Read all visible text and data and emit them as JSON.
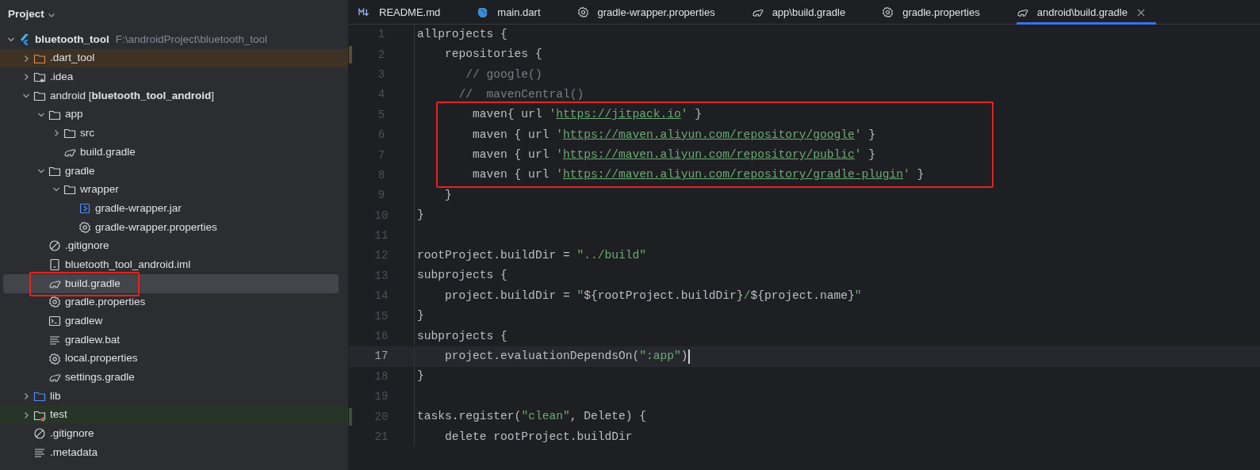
{
  "project_panel": {
    "title": "Project",
    "tree": [
      {
        "label": "bluetooth_tool",
        "path": "F:\\androidProject\\bluetooth_tool",
        "kind": "flutter",
        "expanded": true,
        "selected": false,
        "children": [
          {
            "label": ".dart_tool",
            "kind": "excluded-folder",
            "expanded": false,
            "selected": false
          },
          {
            "label": ".idea",
            "kind": "idea-folder",
            "expanded": false,
            "selected": false
          },
          {
            "label": "android [**bluetooth_tool_android**]",
            "kind": "folder",
            "expanded": true,
            "selected": false,
            "children": [
              {
                "label": "app",
                "kind": "folder",
                "expanded": true,
                "selected": false,
                "children": [
                  {
                    "label": "src",
                    "kind": "folder",
                    "expanded": false,
                    "selected": false
                  },
                  {
                    "label": "build.gradle",
                    "kind": "gradle",
                    "selected": false
                  }
                ]
              },
              {
                "label": "gradle",
                "kind": "folder",
                "expanded": true,
                "selected": false,
                "children": [
                  {
                    "label": "wrapper",
                    "kind": "folder",
                    "expanded": true,
                    "selected": false,
                    "children": [
                      {
                        "label": "gradle-wrapper.jar",
                        "kind": "jar",
                        "selected": false
                      },
                      {
                        "label": "gradle-wrapper.properties",
                        "kind": "settings",
                        "selected": false
                      }
                    ]
                  }
                ]
              },
              {
                "label": ".gitignore",
                "kind": "ignore",
                "selected": false
              },
              {
                "label": "bluetooth_tool_android.iml",
                "kind": "module",
                "selected": false
              },
              {
                "label": "build.gradle",
                "kind": "gradle",
                "selected": true,
                "boxed": true
              },
              {
                "label": "gradle.properties",
                "kind": "settings",
                "selected": false
              },
              {
                "label": "gradlew",
                "kind": "terminal",
                "selected": false
              },
              {
                "label": "gradlew.bat",
                "kind": "text",
                "selected": false
              },
              {
                "label": "local.properties",
                "kind": "settings",
                "selected": false
              },
              {
                "label": "settings.gradle",
                "kind": "gradle",
                "selected": false
              }
            ]
          },
          {
            "label": "lib",
            "kind": "source-folder",
            "expanded": false,
            "selected": false
          },
          {
            "label": "test",
            "kind": "test-folder",
            "expanded": false,
            "selected": false
          },
          {
            "label": ".gitignore",
            "kind": "ignore",
            "selected": false
          },
          {
            "label": ".metadata",
            "kind": "text",
            "selected": false
          }
        ]
      }
    ]
  },
  "editor": {
    "tabs": [
      {
        "label": "README.md",
        "kind": "markdown",
        "selected": false,
        "closable": false
      },
      {
        "label": "main.dart",
        "kind": "dart",
        "selected": false,
        "closable": false
      },
      {
        "label": "gradle-wrapper.properties",
        "kind": "settings",
        "selected": false,
        "closable": false
      },
      {
        "label": "app\\build.gradle",
        "kind": "gradle",
        "selected": false,
        "closable": false
      },
      {
        "label": "gradle.properties",
        "kind": "settings",
        "selected": false,
        "closable": false
      },
      {
        "label": "android\\build.gradle",
        "kind": "gradle",
        "selected": true,
        "closable": true
      }
    ],
    "lines": [
      {
        "number": "1",
        "current": false,
        "tokens": [
          {
            "kind": "plain",
            "text": "allprojects {"
          }
        ]
      },
      {
        "number": "2",
        "current": false,
        "color": "#5c4b2d",
        "tokens": [
          {
            "kind": "plain",
            "text": "    repositories {"
          }
        ]
      },
      {
        "number": "3",
        "current": false,
        "tokens": [
          {
            "kind": "comment",
            "text": "       // google()"
          }
        ]
      },
      {
        "number": "4",
        "current": false,
        "tokens": [
          {
            "kind": "comment",
            "text": "      //  mavenCentral()"
          }
        ]
      },
      {
        "number": "5",
        "current": false,
        "boxed": true,
        "tokens": [
          {
            "kind": "plain",
            "text": "        maven{ url "
          },
          {
            "kind": "string",
            "text": "'"
          },
          {
            "kind": "link",
            "text": "https://jitpack.io"
          },
          {
            "kind": "string",
            "text": "'"
          },
          {
            "kind": "plain",
            "text": " }"
          }
        ]
      },
      {
        "number": "6",
        "current": false,
        "boxed": true,
        "tokens": [
          {
            "kind": "plain",
            "text": "        maven { url "
          },
          {
            "kind": "string",
            "text": "'"
          },
          {
            "kind": "link",
            "text": "https://maven.aliyun.com/repository/google"
          },
          {
            "kind": "string",
            "text": "'"
          },
          {
            "kind": "plain",
            "text": " }"
          }
        ]
      },
      {
        "number": "7",
        "current": false,
        "boxed": true,
        "tokens": [
          {
            "kind": "plain",
            "text": "        maven { url "
          },
          {
            "kind": "string",
            "text": "'"
          },
          {
            "kind": "link",
            "text": "https://maven.aliyun.com/repository/public"
          },
          {
            "kind": "string",
            "text": "'"
          },
          {
            "kind": "plain",
            "text": " }"
          }
        ]
      },
      {
        "number": "8",
        "current": false,
        "boxed": true,
        "tokens": [
          {
            "kind": "plain",
            "text": "        maven { url "
          },
          {
            "kind": "string",
            "text": "'"
          },
          {
            "kind": "link",
            "text": "https://maven.aliyun.com/repository/gradle-plugin"
          },
          {
            "kind": "string",
            "text": "'"
          },
          {
            "kind": "plain",
            "text": " }"
          }
        ]
      },
      {
        "number": "9",
        "current": false,
        "tokens": [
          {
            "kind": "plain",
            "text": "    }"
          }
        ]
      },
      {
        "number": "10",
        "current": false,
        "tokens": [
          {
            "kind": "plain",
            "text": "}"
          }
        ]
      },
      {
        "number": "11",
        "current": false
      },
      {
        "number": "12",
        "current": false,
        "tokens": [
          {
            "kind": "plain",
            "text": "rootProject.buildDir = "
          },
          {
            "kind": "string",
            "text": "\"../build\""
          }
        ]
      },
      {
        "number": "13",
        "current": false,
        "tokens": [
          {
            "kind": "plain",
            "text": "subprojects {"
          }
        ]
      },
      {
        "number": "14",
        "current": false,
        "tokens": [
          {
            "kind": "plain",
            "text": "    project.buildDir = "
          },
          {
            "kind": "string",
            "text": "\""
          },
          {
            "kind": "plain",
            "text": "${rootProject.buildDir}"
          },
          {
            "kind": "string",
            "text": "/"
          },
          {
            "kind": "plain",
            "text": "${project.name}"
          },
          {
            "kind": "string",
            "text": "\""
          }
        ]
      },
      {
        "number": "15",
        "current": false,
        "tokens": [
          {
            "kind": "plain",
            "text": "}"
          }
        ]
      },
      {
        "number": "16",
        "current": false,
        "tokens": [
          {
            "kind": "plain",
            "text": "subprojects {"
          }
        ]
      },
      {
        "number": "17",
        "current": true,
        "tokens": [
          {
            "kind": "plain",
            "text": "    project.evaluationDependsOn("
          },
          {
            "kind": "string",
            "text": "\":app\""
          },
          {
            "kind": "plain",
            "text": ")"
          }
        ]
      },
      {
        "number": "18",
        "current": false,
        "tokens": [
          {
            "kind": "plain",
            "text": "}"
          }
        ]
      },
      {
        "number": "19",
        "current": false
      },
      {
        "number": "20",
        "current": false,
        "color": "#3a5235",
        "tokens": [
          {
            "kind": "plain",
            "text": "tasks.register("
          },
          {
            "kind": "string",
            "text": "\"clean\""
          },
          {
            "kind": "plain",
            "text": ", Delete) {"
          }
        ]
      },
      {
        "number": "21",
        "current": false,
        "tokens": [
          {
            "kind": "plain",
            "text": "    delete rootProject.buildDir"
          }
        ]
      }
    ]
  }
}
